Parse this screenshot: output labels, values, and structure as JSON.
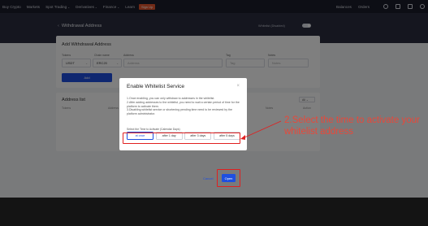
{
  "nav": {
    "items": [
      "Buy Crypto",
      "Markets",
      "Spot Trading",
      "Derivatives",
      "Finance",
      "Learn"
    ],
    "signup_label": "Sign Up",
    "right_items": [
      "Balances",
      "Orders"
    ]
  },
  "banner": {
    "title": "Withdrawal Address",
    "whitelist_label": "Whitelist (Disabled)"
  },
  "form": {
    "title": "Add Withdrawal Address",
    "token_label": "Tokens",
    "token_value": "USDT",
    "chain_label": "Chain name",
    "chain_value": "ERC20",
    "address_label": "Address",
    "address_placeholder": "Address",
    "tag_label": "Tag",
    "tag_placeholder": "Tag",
    "notes_label": "Notes",
    "notes_placeholder": "Notes",
    "add_label": "Add"
  },
  "list": {
    "title": "Address list",
    "headers": [
      "Tokens",
      "Address",
      "Notes",
      "Action"
    ],
    "filter_value": "All"
  },
  "modal": {
    "title": "Enable Whitelist Service",
    "close": "×",
    "body": [
      "1.Once enabling, you can only withdraw to addresses in the whitelist.",
      "2.After adding addresses to the whitelist, you need to wait a certain period of time for the platform to activate them.",
      "3.Disabling whitelist service or shortening pending time need to be reviewed by the platform administrator."
    ],
    "prompt": "Select the Time to Activate (Calendar Days)",
    "options": [
      "at once",
      "after 1 day",
      "after 3 days",
      "after 5 days"
    ],
    "selected_option": "at once",
    "cancel_label": "Cancel",
    "open_label": "Open"
  },
  "annotation": {
    "text": "2.Select the time  to activate your whitelist address",
    "color": "#e8483a"
  },
  "colors": {
    "accent": "#1e4fe0",
    "highlight": "#e02020"
  }
}
